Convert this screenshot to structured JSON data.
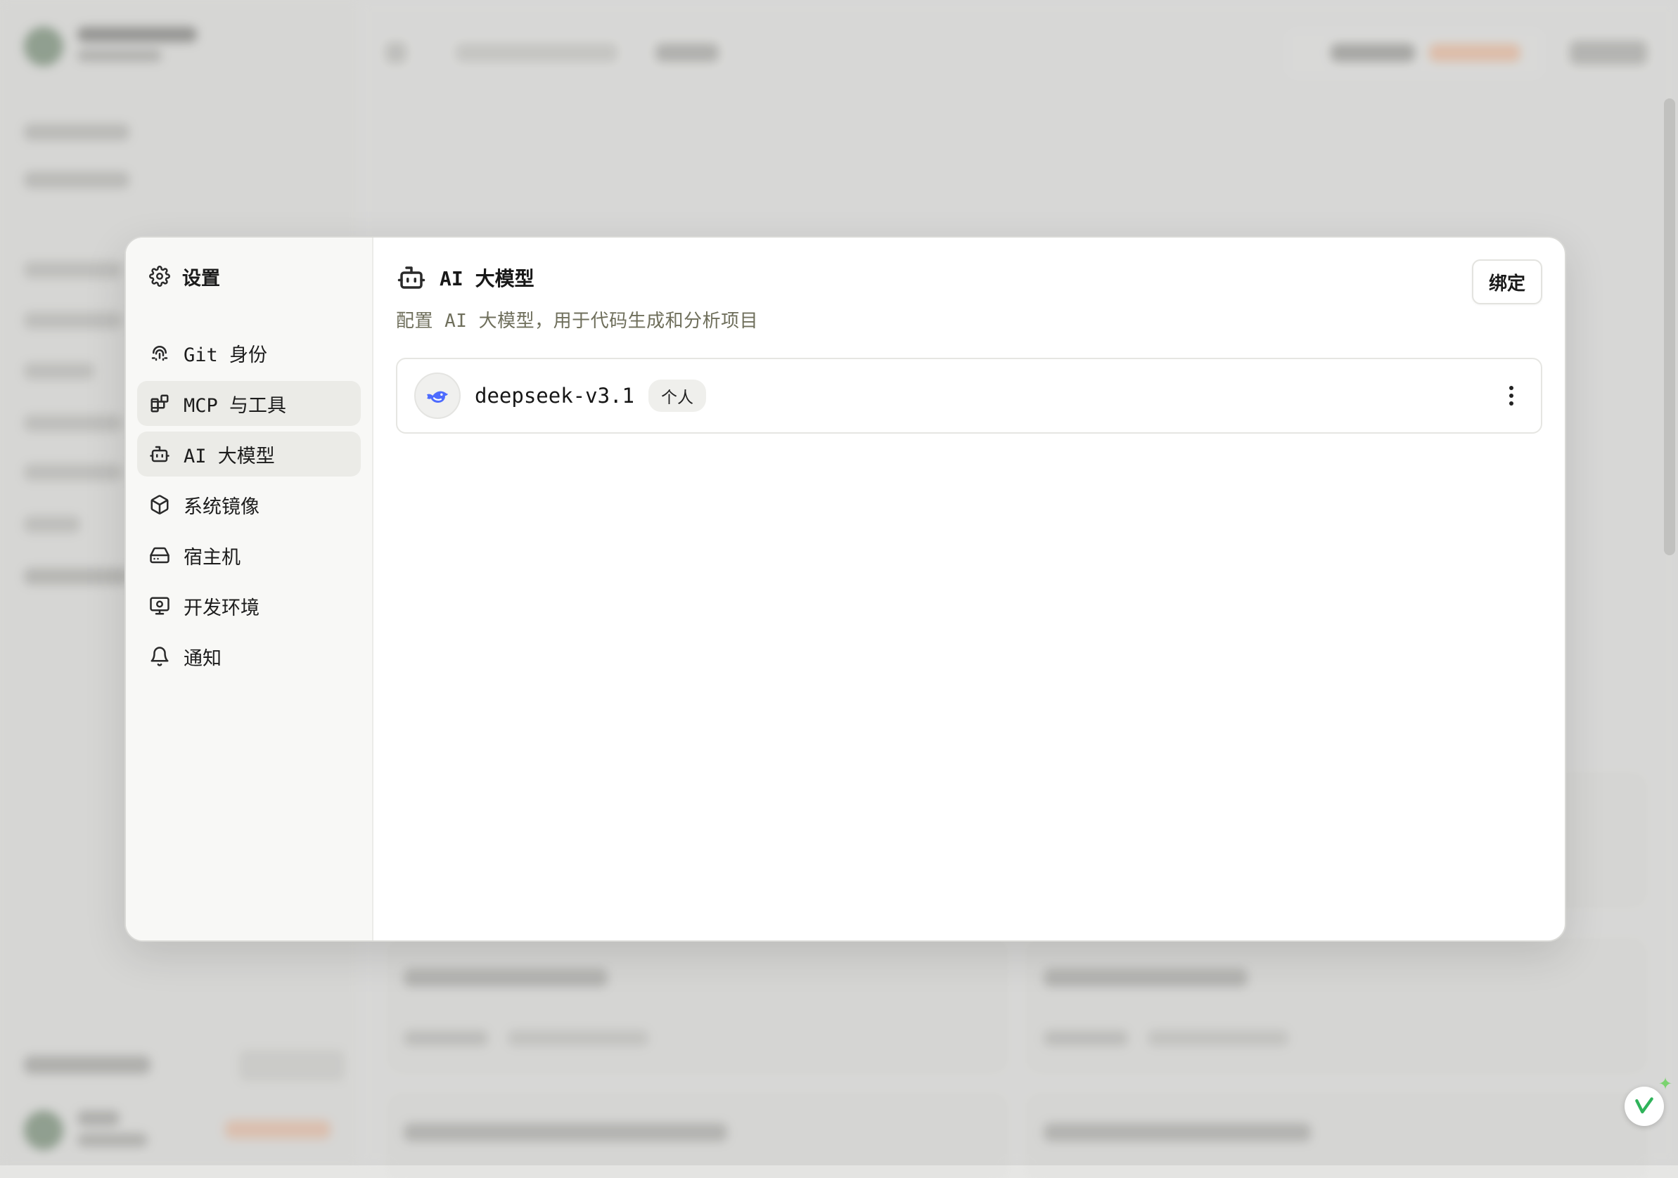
{
  "settings": {
    "title": "设置",
    "nav": [
      {
        "label": "Git 身份",
        "icon": "fingerprint-icon"
      },
      {
        "label": "MCP 与工具",
        "icon": "blocks-icon"
      },
      {
        "label": "AI 大模型",
        "icon": "bot-icon"
      },
      {
        "label": "系统镜像",
        "icon": "cube-icon"
      },
      {
        "label": "宿主机",
        "icon": "hard-drive-icon"
      },
      {
        "label": "开发环境",
        "icon": "monitor-icon"
      },
      {
        "label": "通知",
        "icon": "bell-icon"
      }
    ],
    "active_index": 2
  },
  "panel": {
    "title": "AI 大模型",
    "subtitle": "配置 AI 大模型，用于代码生成和分析项目",
    "bind_label": "绑定",
    "models": [
      {
        "name": "deepseek-v3.1",
        "tag": "个人",
        "logo": "deepseek-whale-icon"
      }
    ]
  },
  "colors": {
    "accent_active_bg": "#ebebe7",
    "subtitle": "#6f6f5c",
    "deepseek_blue": "#4d6bfe"
  }
}
